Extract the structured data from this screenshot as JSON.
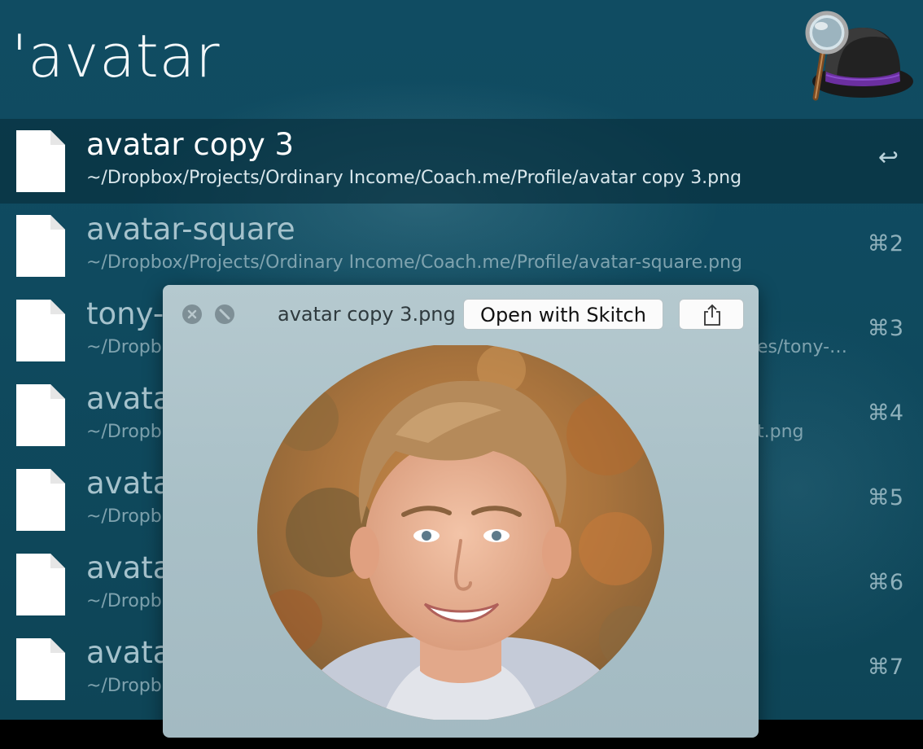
{
  "search": {
    "query": "'avatar"
  },
  "app": {
    "logo_icon": "alfred-hat-magnifier-icon"
  },
  "results": [
    {
      "title": "avatar copy 3",
      "subtitle": "~/Dropbox/Projects/Ordinary Income/Coach.me/Profile/avatar copy 3.png",
      "shortcut": "↩",
      "selected": true
    },
    {
      "title": "avatar-square",
      "subtitle": "~/Dropbox/Projects/Ordinary Income/Coach.me/Profile/avatar-square.png",
      "shortcut": "⌘2",
      "selected": false
    },
    {
      "title": "tony-",
      "subtitle": "~/Dropb",
      "subtitle_tail": "es/tony-…",
      "shortcut": "⌘3",
      "selected": false
    },
    {
      "title": "avata",
      "subtitle": "~/Dropb",
      "subtitle_tail": "t.png",
      "shortcut": "⌘4",
      "selected": false
    },
    {
      "title": "avata",
      "subtitle": "~/Dropb",
      "shortcut": "⌘5",
      "selected": false
    },
    {
      "title": "avata",
      "subtitle": "~/Dropb",
      "shortcut": "⌘6",
      "selected": false
    },
    {
      "title": "avata",
      "subtitle": "~/Dropb",
      "shortcut": "⌘7",
      "selected": false
    }
  ],
  "preview": {
    "filename": "avatar copy 3.png",
    "open_button_label": "Open with Skitch",
    "close_icon": "close-icon",
    "fullscreen_icon": "fullscreen-icon",
    "share_icon": "share-icon",
    "image_icon": "profile-photo"
  }
}
